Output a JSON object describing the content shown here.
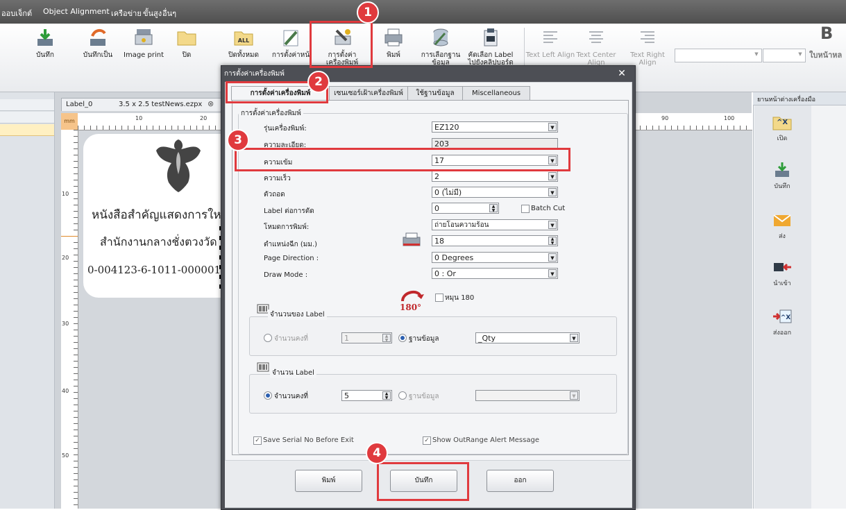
{
  "menu": {
    "items": [
      "ออบเจ็กต์",
      "Object Alignment",
      "เครือข่าย",
      "ขั้นสูง",
      "อื่นๆ"
    ]
  },
  "toolbar": {
    "buttons": [
      {
        "label": "บันทึก",
        "icon": "save-icon"
      },
      {
        "label": "บันทึกเป็น",
        "icon": "save-as-icon"
      },
      {
        "label": "Image print",
        "icon": "image-print-icon"
      },
      {
        "label": "ปิด",
        "icon": "folder-icon"
      },
      {
        "label": "ปิดทั้งหมด",
        "icon": "close-all-icon"
      },
      {
        "label": "การตั้งค่าหน้",
        "icon": "page-setup-icon"
      },
      {
        "label": "การตั้งค่าเครื่องพิมพ์",
        "icon": "printer-settings-icon"
      },
      {
        "label": "พิมพ์",
        "icon": "printer-icon"
      },
      {
        "label": "การเลือกฐานข้อมูล",
        "icon": "database-icon"
      },
      {
        "label": "คัดเลือก Label ไปยังคลิปบอร์ด",
        "icon": "clipboard-icon"
      }
    ],
    "align": [
      {
        "label": "Text Left Align"
      },
      {
        "label": "Text Center Align"
      },
      {
        "label": "Text Right Align"
      }
    ],
    "bold_label": "B",
    "right_text": "ใบหน้าหล"
  },
  "document": {
    "tab_title": "Label_0",
    "tab_size": "3.5 x 2.5 testNews.ezpx",
    "ruler_unit": "mm",
    "hruler": [
      "10",
      "20",
      "90",
      "100"
    ],
    "vruler": [
      "10",
      "20",
      "30",
      "40",
      "50"
    ],
    "label_lines": [
      "หนังสือสำคัญแสดงการให",
      "สำนักงานกลางชั่งตวงวัด",
      "0-004123-6-1011-000001-66"
    ]
  },
  "right_panel": {
    "title": "ยานหน้าต่างเครื่องมือ",
    "buttons": [
      {
        "label": "เปิด",
        "icon": "open-icon"
      },
      {
        "label": "บันทึก",
        "icon": "save-icon"
      },
      {
        "label": "ส่ง",
        "icon": "send-icon"
      },
      {
        "label": "นำเข้า",
        "icon": "import-icon"
      },
      {
        "label": "ส่งออก",
        "icon": "export-icon"
      }
    ]
  },
  "dialog": {
    "title": "การตั้งค่าเครื่องพิมพ์",
    "tabs": [
      "การตั้งค่าเครื่องพิมพ์",
      "เซนเซอร์เฝ้าเครื่องพิมพ์",
      "ใช้ฐานข้อมูล",
      "Miscellaneous"
    ],
    "group_title": "การตั้งค่าเครื่องพิมพ์",
    "fields": {
      "model": {
        "label": "รุ่นเครื่องพิมพ์:",
        "value": "EZ120"
      },
      "resolution": {
        "label": "ความละเอียด:",
        "value": "203"
      },
      "darkness": {
        "label": "ความเข้ม",
        "value": "17"
      },
      "speed": {
        "label": "ความเร็ว",
        "value": "2"
      },
      "cutter": {
        "label": "ตัวถอด",
        "value": "0 (ไม่มี)"
      },
      "label_per_cut": {
        "label": "Label ต่อการตัด",
        "value": "0"
      },
      "print_mode": {
        "label": "โหมดการพิมพ์:",
        "value": "ถ่ายโอนความร้อน"
      },
      "tear_position": {
        "label": "ตำแหน่งฉีก (มม.)",
        "value": "18"
      },
      "page_direction": {
        "label": "Page Direction :",
        "value": "0 Degrees"
      },
      "draw_mode": {
        "label": "Draw Mode :",
        "value": "0 : Or"
      }
    },
    "batch_cut": "Batch Cut",
    "rotate_label": "หมุน 180",
    "rotate_badge": "180°",
    "qty_group": {
      "title": "จำนวนของ Label",
      "radio_const": "จำนวนคงที่",
      "const_value": "1",
      "radio_db": "ฐานข้อมูล",
      "db_value": "_Qty"
    },
    "copies_group": {
      "title": "จำนวน Label",
      "radio_const": "จำนวนคงที่",
      "const_value": "5",
      "radio_db": "ฐานข้อมูล",
      "db_value": ""
    },
    "save_serial": "Save Serial No Before Exit",
    "show_outrange": "Show OutRange Alert Message",
    "buttons": {
      "print": "พิมพ์",
      "save": "บันทึก",
      "exit": "ออก"
    }
  },
  "annotations": [
    "1",
    "2",
    "3",
    "4"
  ],
  "colors": {
    "highlight": "#e03a3e",
    "dialog_frame": "#4d4f55"
  }
}
